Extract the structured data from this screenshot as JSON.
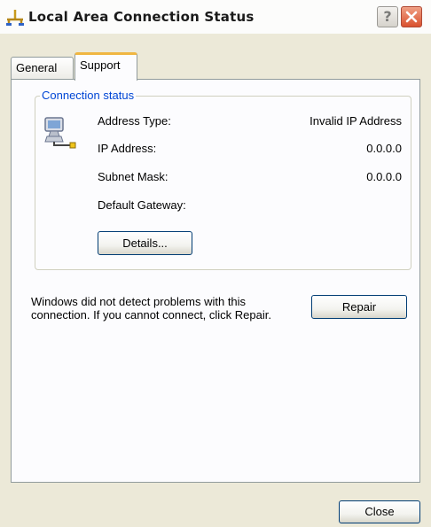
{
  "window": {
    "title": "Local Area Connection Status",
    "help_label": "?",
    "close_label": ""
  },
  "tabs": [
    {
      "label": "General",
      "selected": false
    },
    {
      "label": "Support",
      "selected": true
    }
  ],
  "connection_status": {
    "group_label": "Connection status",
    "rows": [
      {
        "label": "Address Type:",
        "value": "Invalid IP Address"
      },
      {
        "label": "IP Address:",
        "value": "0.0.0.0"
      },
      {
        "label": "Subnet Mask:",
        "value": "0.0.0.0"
      },
      {
        "label": "Default Gateway:",
        "value": ""
      }
    ],
    "details_label": "Details..."
  },
  "repair": {
    "message": "Windows did not detect problems with this connection. If you cannot connect, click Repair.",
    "button_label": "Repair"
  },
  "footer": {
    "close_label": "Close"
  },
  "icons": {
    "title_icon": "network-connection-icon",
    "status_icon": "network-computer-icon"
  },
  "colors": {
    "group_label": "#0046d5",
    "selected_tab_accent": "#f0b642",
    "close_button": "#d9512e"
  }
}
